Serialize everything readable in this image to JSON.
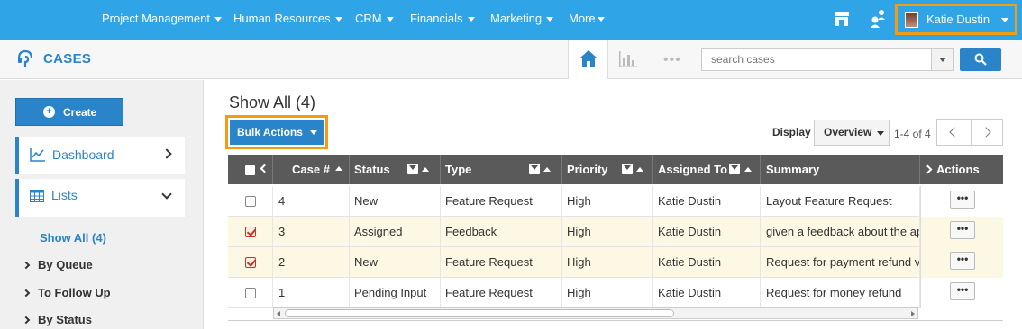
{
  "nav": {
    "items": [
      {
        "label": "Project Management"
      },
      {
        "label": "Human Resources"
      },
      {
        "label": "CRM"
      },
      {
        "label": "Financials"
      },
      {
        "label": "Marketing"
      },
      {
        "label": "More"
      }
    ],
    "user_name": "Katie Dustin",
    "icons": [
      "store-icon",
      "people-icon"
    ],
    "accent": "#2fa4e7",
    "highlight": "#f39c12"
  },
  "module": {
    "title": "CASES",
    "search_placeholder": "search cases",
    "more_dots": "•••"
  },
  "sidebar": {
    "create_label": "Create",
    "cards": [
      {
        "label": "Dashboard"
      },
      {
        "label": "Lists"
      }
    ],
    "active_link": "Show All (4)",
    "sub_items": [
      {
        "label": "By Queue"
      },
      {
        "label": "To Follow Up"
      },
      {
        "label": "By Status"
      }
    ]
  },
  "main": {
    "title": "Show All (4)",
    "bulk_actions": "Bulk Actions",
    "display_label": "Display",
    "display_value": "Overview",
    "range": "1-4 of 4"
  },
  "table": {
    "headers": {
      "case": "Case #",
      "status": "Status",
      "type": "Type",
      "priority": "Priority",
      "assigned": "Assigned To",
      "summary": "Summary",
      "actions": "Actions"
    },
    "rows": [
      {
        "case": "4",
        "status": "New",
        "type": "Feature Request",
        "priority": "High",
        "assigned": "Katie Dustin",
        "summary": "Layout Feature Request",
        "checked": false,
        "action": "•••"
      },
      {
        "case": "3",
        "status": "Assigned",
        "type": "Feedback",
        "priority": "High",
        "assigned": "Katie Dustin",
        "summary": "given a feedback about the app",
        "checked": true,
        "action": "•••"
      },
      {
        "case": "2",
        "status": "New",
        "type": "Feature Request",
        "priority": "High",
        "assigned": "Katie Dustin",
        "summary": "Request for payment refund via",
        "checked": true,
        "action": "•••"
      },
      {
        "case": "1",
        "status": "Pending Input",
        "type": "Feature Request",
        "priority": "High",
        "assigned": "Katie Dustin",
        "summary": "Request for money refund",
        "checked": false,
        "action": "•••"
      }
    ]
  }
}
